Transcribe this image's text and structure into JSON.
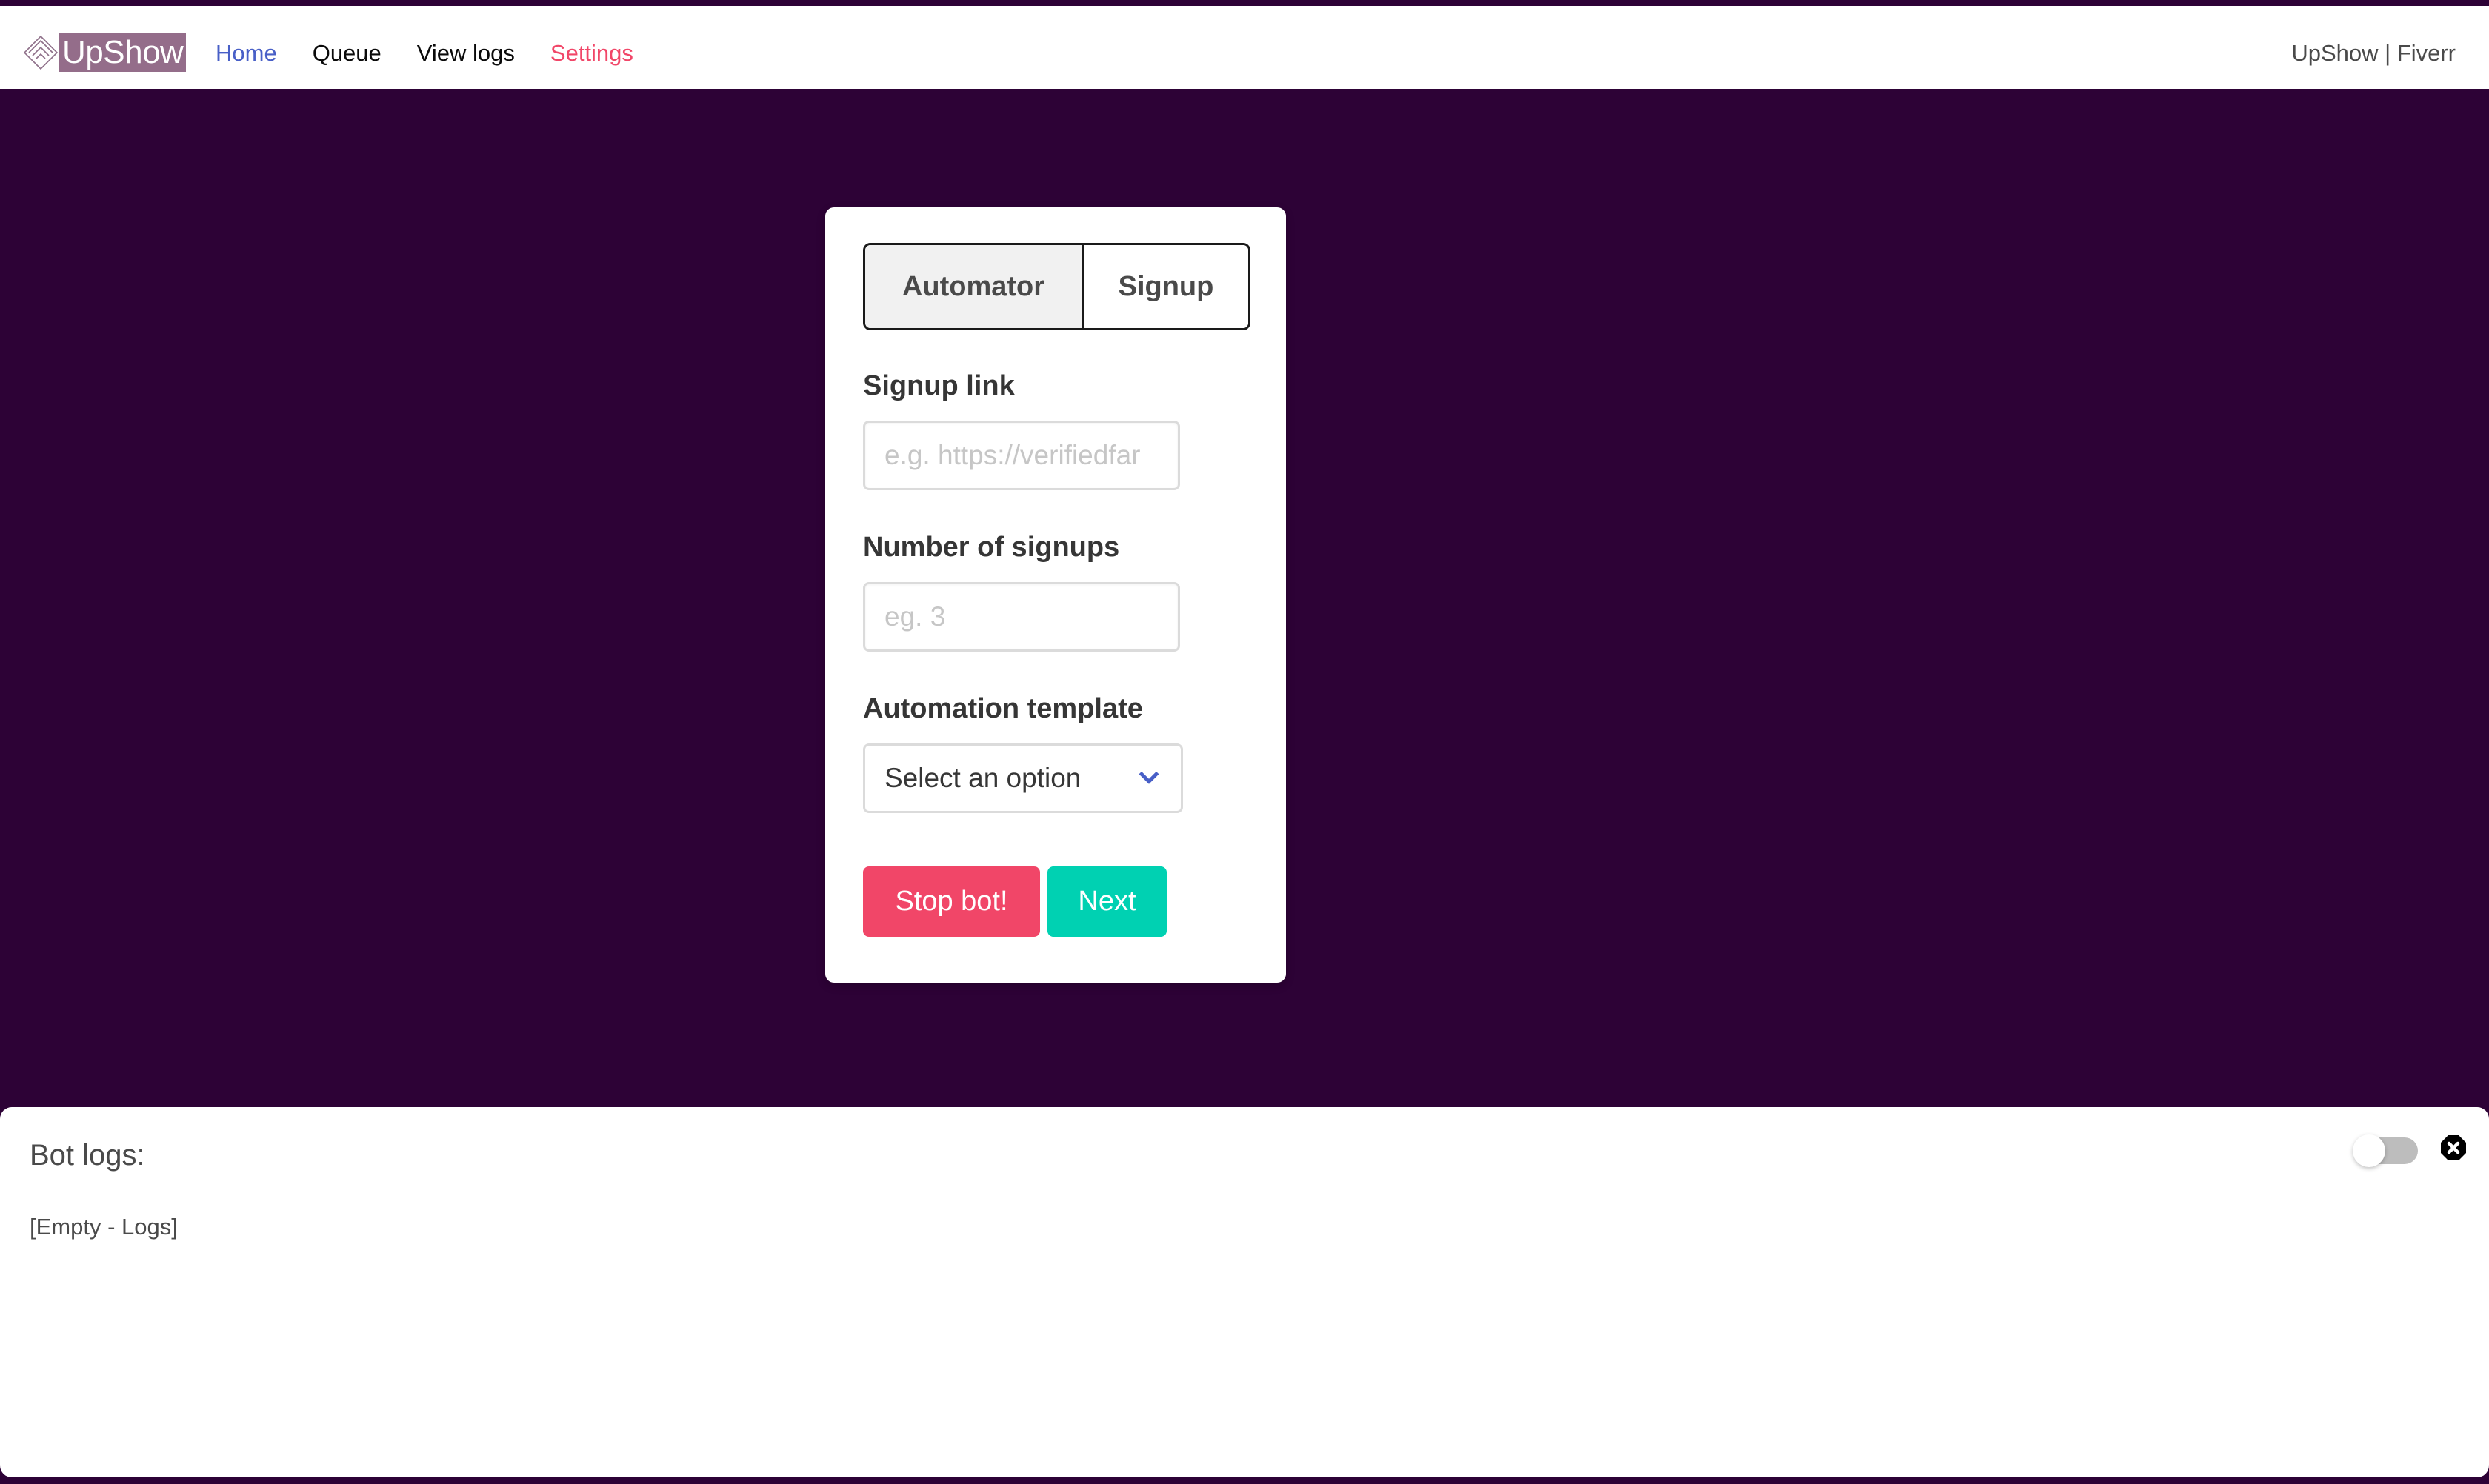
{
  "header": {
    "logo_text": "UpShow",
    "nav": [
      {
        "label": "Home",
        "style": "home"
      },
      {
        "label": "Queue",
        "style": "plain"
      },
      {
        "label": "View logs",
        "style": "plain"
      },
      {
        "label": "Settings",
        "style": "settings"
      }
    ],
    "right_text": "UpShow | Fiverr"
  },
  "form": {
    "tabs": [
      {
        "label": "Automator",
        "active": true
      },
      {
        "label": "Signup",
        "active": false
      }
    ],
    "signup_link": {
      "label": "Signup link",
      "value": "",
      "placeholder": "e.g. https://verifiedfar"
    },
    "number_of_signups": {
      "label": "Number of signups",
      "value": "",
      "placeholder": "eg. 3"
    },
    "automation_template": {
      "label": "Automation template",
      "selected": "Select an option"
    },
    "buttons": {
      "stop_label": "Stop bot!",
      "next_label": "Next"
    }
  },
  "logs": {
    "title": "Bot logs:",
    "content": "[Empty - Logs]",
    "toggle_on": false
  },
  "colors": {
    "background": "#2d0236",
    "logo_bg": "#946d8a",
    "link_blue": "#485fc7",
    "danger": "#f14668",
    "primary": "#00d1b2"
  }
}
